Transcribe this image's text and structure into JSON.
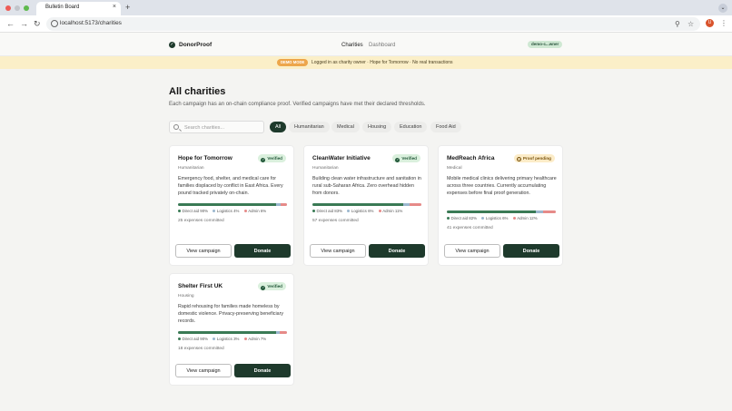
{
  "browser": {
    "tab_title": "Bulletin Board",
    "tab_close": "×",
    "new_tab": "+",
    "url": "localhost:5173/charities",
    "profile_initial": "U",
    "traffic_colors": [
      "#ee5b56",
      "#c2c5cb",
      "#5fba4e"
    ]
  },
  "header": {
    "brand": "DonorProof",
    "nav": [
      "Charities",
      "Dashboard"
    ],
    "user_pill": "demo-c...wner"
  },
  "banner": {
    "badge": "DEMO MODE",
    "text": "Logged in as charity owner · Hope for Tomorrow · No real transactions"
  },
  "page": {
    "title": "All charities",
    "subtitle": "Each campaign has an on-chain compliance proof. Verified campaigns have met their declared thresholds."
  },
  "search": {
    "placeholder": "Search charities..."
  },
  "filters": [
    "All",
    "Humanitarian",
    "Medical",
    "Housing",
    "Education",
    "Food Aid"
  ],
  "colors": {
    "accent": "#1e3a2c",
    "direct": "#3a7a55",
    "logistics": "#9bb7ce",
    "admin": "#e68a88"
  },
  "cards": [
    {
      "title": "Hope for Tomorrow",
      "status": "Verified",
      "category": "Humanitarian",
      "description": "Emergency food, shelter, and medical care for families displaced by conflict in East Africa. Every pound tracked privately on-chain.",
      "split": {
        "direct": 90,
        "logistics": 4,
        "admin": 6
      },
      "legend": [
        "Direct aid 90%",
        "Logistics 4%",
        "Admin 6%"
      ],
      "expenses": "25 expenses committed",
      "view_label": "View campaign",
      "donate_label": "Donate"
    },
    {
      "title": "CleanWater Initiative",
      "status": "Verified",
      "category": "Humanitarian",
      "description": "Building clean water infrastructure and sanitation in rural sub-Saharan Africa. Zero overhead hidden from donors.",
      "split": {
        "direct": 83,
        "logistics": 6,
        "admin": 11
      },
      "legend": [
        "Direct aid 83%",
        "Logistics 6%",
        "Admin 11%"
      ],
      "expenses": "57 expenses committed",
      "view_label": "View campaign",
      "donate_label": "Donate"
    },
    {
      "title": "MedReach Africa",
      "status": "Proof pending",
      "category": "Medical",
      "description": "Mobile medical clinics delivering primary healthcare across three countries. Currently accumulating expenses before final proof generation.",
      "split": {
        "direct": 82,
        "logistics": 6,
        "admin": 12
      },
      "legend": [
        "Direct aid 82%",
        "Logistics 6%",
        "Admin 12%"
      ],
      "expenses": "41 expenses committed",
      "view_label": "View campaign",
      "donate_label": "Donate"
    },
    {
      "title": "Shelter First UK",
      "status": "Verified",
      "category": "Housing",
      "description": "Rapid rehousing for families made homeless by domestic violence. Privacy-preserving beneficiary records.",
      "split": {
        "direct": 90,
        "logistics": 3,
        "admin": 7
      },
      "legend": [
        "Direct aid 90%",
        "Logistics 3%",
        "Admin 7%"
      ],
      "expenses": "18 expenses committed",
      "view_label": "View campaign",
      "donate_label": "Donate"
    }
  ]
}
